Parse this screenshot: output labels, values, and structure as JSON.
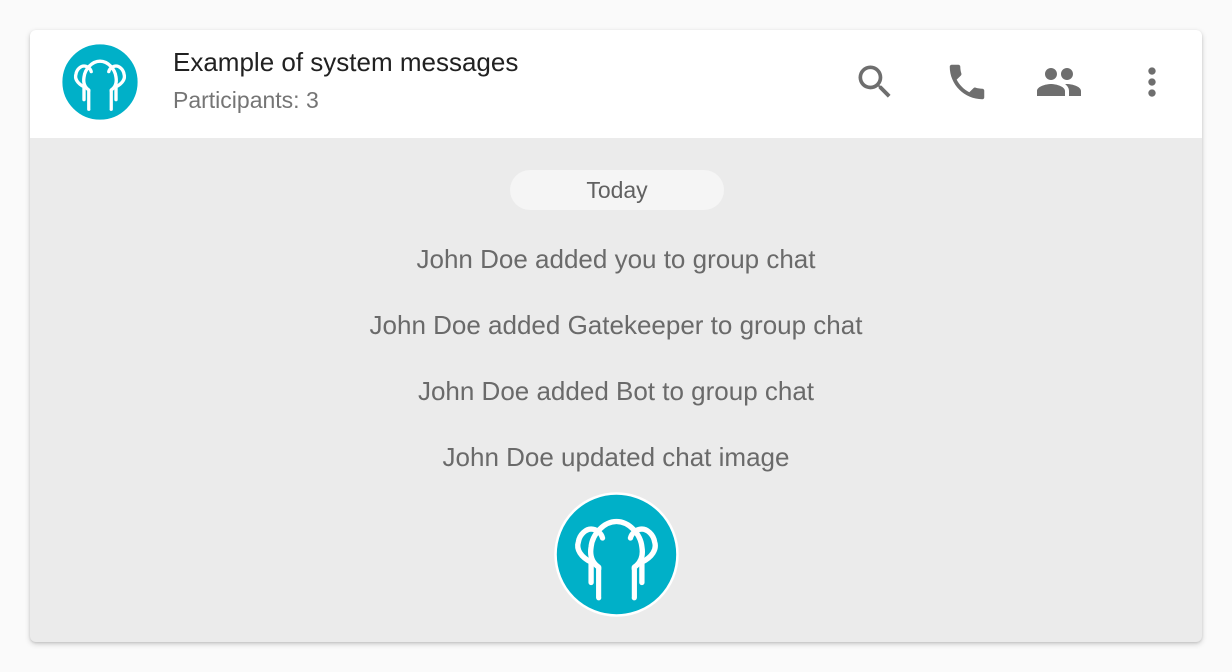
{
  "chat": {
    "title": "Example of system messages",
    "participants": "Participants: 3",
    "avatar_icon": "group-people-icon",
    "avatar_color": "#00b0c8"
  },
  "actions": [
    {
      "icon": "search-icon"
    },
    {
      "icon": "phone-icon"
    },
    {
      "icon": "participants-icon"
    },
    {
      "icon": "more-vertical-icon"
    }
  ],
  "colors": {
    "icon": "#6e6e6e",
    "message_text": "#6a6a6a",
    "background": "#ebebeb"
  },
  "messages": {
    "date_label": "Today",
    "items": [
      {
        "text": "John Doe added you to group chat"
      },
      {
        "text": "John Doe added Gatekeeper to group chat"
      },
      {
        "text": "John Doe added Bot to group chat"
      },
      {
        "text": "John Doe updated chat image"
      }
    ],
    "image_icon": "group-people-icon"
  }
}
